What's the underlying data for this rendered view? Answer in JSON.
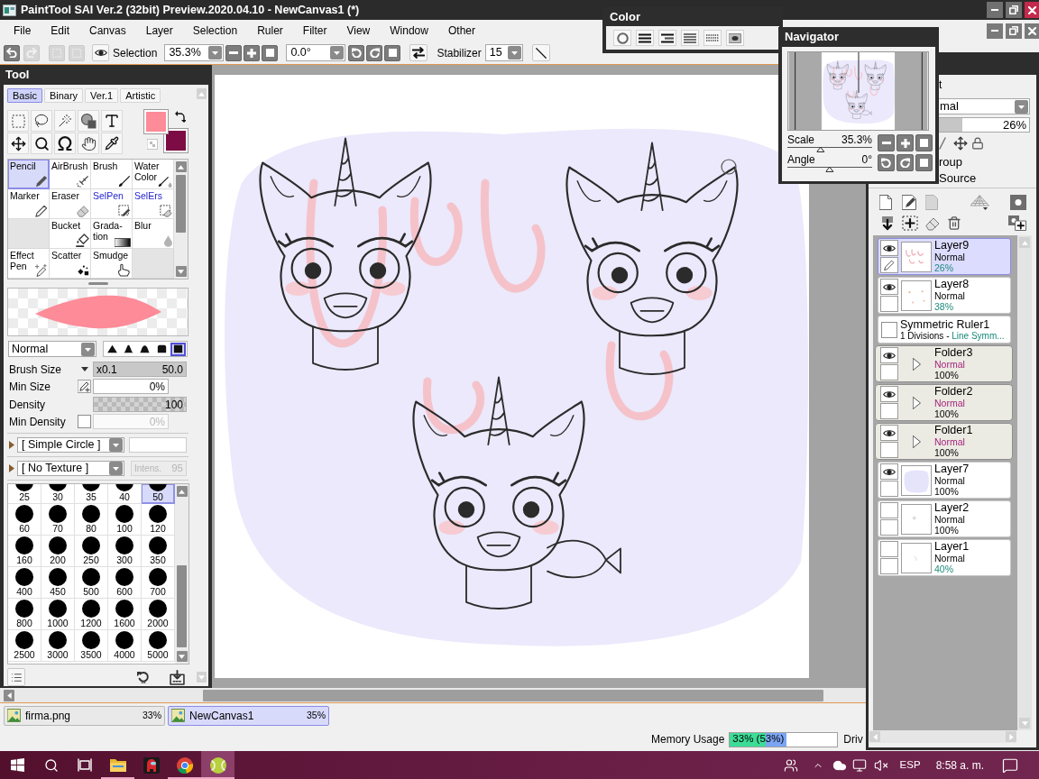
{
  "window": {
    "title": "PaintTool SAI Ver.2 (32bit) Preview.2020.04.10 - NewCanvas1 (*)"
  },
  "menu": [
    "File",
    "Edit",
    "Canvas",
    "Layer",
    "Selection",
    "Ruler",
    "Filter",
    "View",
    "Window",
    "Other"
  ],
  "toolbar": {
    "history": [
      {
        "disabled": false
      },
      {
        "disabled": true
      }
    ],
    "selection_actions": [
      {
        "disabled": true
      },
      {
        "disabled": true
      }
    ],
    "selection_label": "Selection",
    "zoom": "35.3%",
    "angle": "0.0°",
    "stabilizer_label": "Stabilizer",
    "stabilizer": "15"
  },
  "color_panel": {
    "title": "Color"
  },
  "navigator": {
    "title": "Navigator",
    "scale": {
      "label": "Scale",
      "value": "35.3%",
      "level": 0.39
    },
    "angle": {
      "label": "Angle",
      "value": "0°",
      "level": 0.5
    }
  },
  "tool_panel": {
    "title": "Tool",
    "tabs": [
      {
        "label": "Basic",
        "selected": true
      },
      {
        "label": "Binary",
        "selected": false
      },
      {
        "label": "Ver.1",
        "selected": false
      },
      {
        "label": "Artistic",
        "selected": false
      }
    ],
    "swatches": [
      {
        "kind": "foreground",
        "color": "#fd8b98"
      },
      {
        "kind": "background",
        "color": "#7d0c45"
      }
    ],
    "tools": [
      {
        "kind": "tool",
        "label": "Pencil",
        "selected": true
      },
      {
        "kind": "tool",
        "label": "AirBrush",
        "selected": false
      },
      {
        "kind": "tool",
        "label": "Brush",
        "selected": false
      },
      {
        "kind": "tool",
        "label": "Water Color",
        "selected": false
      },
      {
        "kind": "tool",
        "label": "Marker",
        "selected": false
      },
      {
        "kind": "tool",
        "label": "Eraser",
        "selected": false
      },
      {
        "kind": "selection",
        "label": "SelPen",
        "selected": false
      },
      {
        "kind": "selection",
        "label": "SelErs",
        "selected": false
      },
      {
        "kind": "empty"
      },
      {
        "kind": "tool",
        "label": "Bucket",
        "selected": false
      },
      {
        "kind": "tool",
        "label": "Grada-tion",
        "selected": false
      },
      {
        "kind": "tool",
        "label": "Blur",
        "selected": false
      },
      {
        "kind": "tool",
        "label": "Effect Pen",
        "selected": false
      },
      {
        "kind": "tool",
        "label": "Scatter",
        "selected": false
      },
      {
        "kind": "tool",
        "label": "Smudge",
        "selected": false
      },
      {
        "kind": "empty"
      }
    ],
    "blend_mode": "Normal",
    "tip_shapes": [
      {
        "selected": false
      },
      {
        "selected": false
      },
      {
        "selected": false
      },
      {
        "selected": false
      },
      {
        "selected": true
      }
    ],
    "params": [
      {
        "kind": "size",
        "label": "Brush Size",
        "prefix": "x0.1",
        "value": "50.0",
        "level": 1
      },
      {
        "kind": "pressure",
        "label": "Min Size",
        "value": "0%"
      },
      {
        "kind": "density",
        "label": "Density",
        "value": "100",
        "level": 1
      },
      {
        "kind": "toggle",
        "label": "Min Density",
        "value": "0%",
        "checked": false,
        "disabled": true
      }
    ],
    "shape": {
      "label": "[ Simple Circle ]",
      "expanded": false
    },
    "texture": {
      "label": "[ No Texture ]",
      "expanded": false,
      "intensity_label": "Intens.",
      "intensity": "95",
      "disabled": true
    },
    "sizes": [
      {
        "label": "25",
        "selected": false
      },
      {
        "label": "30",
        "selected": false
      },
      {
        "label": "35",
        "selected": false
      },
      {
        "label": "40",
        "selected": false
      },
      {
        "label": "50",
        "selected": true
      },
      {
        "label": "60",
        "selected": false
      },
      {
        "label": "70",
        "selected": false
      },
      {
        "label": "80",
        "selected": false
      },
      {
        "label": "100",
        "selected": false
      },
      {
        "label": "120",
        "selected": false
      },
      {
        "label": "160",
        "selected": false
      },
      {
        "label": "200",
        "selected": false
      },
      {
        "label": "250",
        "selected": false
      },
      {
        "label": "300",
        "selected": false
      },
      {
        "label": "350",
        "selected": false
      },
      {
        "label": "400",
        "selected": false
      },
      {
        "label": "450",
        "selected": false
      },
      {
        "label": "500",
        "selected": false
      },
      {
        "label": "600",
        "selected": false
      },
      {
        "label": "700",
        "selected": false
      },
      {
        "label": "800",
        "selected": false
      },
      {
        "label": "1000",
        "selected": false
      },
      {
        "label": "1200",
        "selected": false
      },
      {
        "label": "1600",
        "selected": false
      },
      {
        "label": "2000",
        "selected": false
      },
      {
        "label": "2500",
        "selected": false
      },
      {
        "label": "3000",
        "selected": false
      },
      {
        "label": "3500",
        "selected": false
      },
      {
        "label": "4000",
        "selected": false
      },
      {
        "label": "5000",
        "selected": false
      }
    ]
  },
  "layer_panel": {
    "header": "t",
    "blend": "mal",
    "opacity": {
      "value": "26%",
      "level": 0.26
    },
    "options": [
      "roup",
      "Source"
    ],
    "layers": [
      {
        "kind": "layer",
        "name": "Layer9",
        "blend": "Normal",
        "opacity": "26%",
        "visible": true,
        "selected": true
      },
      {
        "kind": "layer",
        "name": "Layer8",
        "blend": "Normal",
        "opacity": "38%",
        "visible": true,
        "selected": false
      },
      {
        "kind": "ruler",
        "name": "Symmetric Ruler1",
        "detail": "1 Divisions -",
        "mode": "Line Symm...",
        "visible": false,
        "selected": false
      },
      {
        "kind": "folder",
        "name": "Folder3",
        "blend": "Normal",
        "opacity": "100%",
        "visible": true,
        "selected": false,
        "expanded": false
      },
      {
        "kind": "folder",
        "name": "Folder2",
        "blend": "Normal",
        "opacity": "100%",
        "visible": true,
        "selected": false,
        "expanded": false
      },
      {
        "kind": "folder",
        "name": "Folder1",
        "blend": "Normal",
        "opacity": "100%",
        "visible": true,
        "selected": false,
        "expanded": false
      },
      {
        "kind": "layer",
        "name": "Layer7",
        "blend": "Normal",
        "opacity": "100%",
        "visible": true,
        "selected": false
      },
      {
        "kind": "layer",
        "name": "Layer2",
        "blend": "Normal",
        "opacity": "100%",
        "visible": false,
        "selected": false
      },
      {
        "kind": "layer",
        "name": "Layer1",
        "blend": "Normal",
        "opacity": "40%",
        "visible": false,
        "selected": false
      }
    ]
  },
  "documents": [
    {
      "name": "firma.png",
      "zoom": "33%",
      "selected": false
    },
    {
      "name": "NewCanvas1",
      "zoom": "35%",
      "selected": true
    }
  ],
  "status": {
    "memory_label": "Memory Usage",
    "memory": {
      "reading": "33% (53%)",
      "bars": [
        {
          "level": 0.33,
          "color": "#3ddc97"
        },
        {
          "level": 0.53,
          "color": "#7ba4f4"
        }
      ]
    },
    "drive_label": "Driv"
  },
  "taskbar": {
    "apps": [
      {
        "running": true,
        "active": false
      },
      {
        "running": false,
        "active": false
      },
      {
        "running": true,
        "active": false
      },
      {
        "running": true,
        "active": true
      }
    ],
    "language": "ESP",
    "clock": "8:58 a. m."
  }
}
